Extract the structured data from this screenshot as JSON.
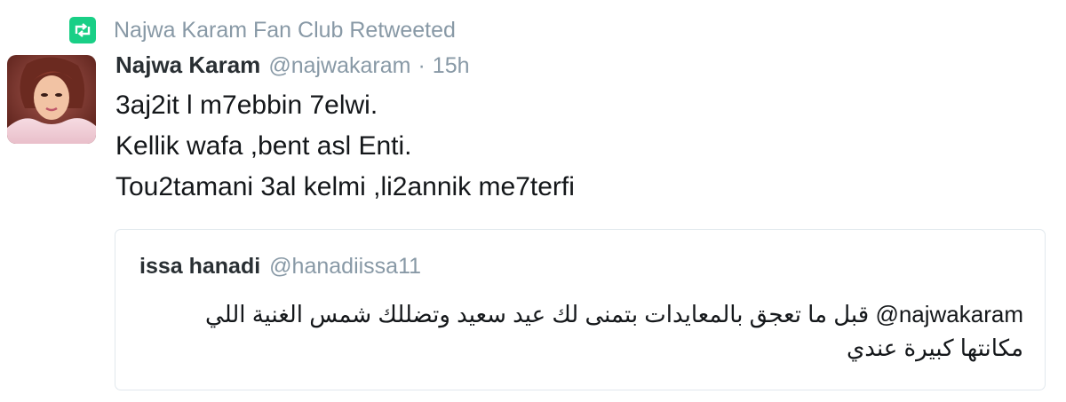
{
  "colors": {
    "retweet_green": "#19cf86",
    "muted": "#8899a6",
    "text": "#14171a",
    "border": "#e1e8ed"
  },
  "retweet": {
    "icon": "retweet-icon",
    "label": "Najwa Karam Fan Club Retweeted"
  },
  "tweet": {
    "avatar": "avatar",
    "display_name": "Najwa Karam",
    "handle": "@najwakaram",
    "separator": "·",
    "time": "15h",
    "lines": [
      "3aj2it l m7ebbin 7elwi.",
      "Kellik wafa ,bent asl Enti.",
      "Tou2tamani 3al kelmi ,li2annik me7terfi"
    ]
  },
  "quote": {
    "display_name": "issa hanadi",
    "handle": "@hanadiissa11",
    "mention": "@najwakaram",
    "text": "قبل ما تعجق بالمعايدات بتمنى لك عيد سعيد وتضللك شمس الغنية اللي مكانتها كبيرة عندي"
  }
}
